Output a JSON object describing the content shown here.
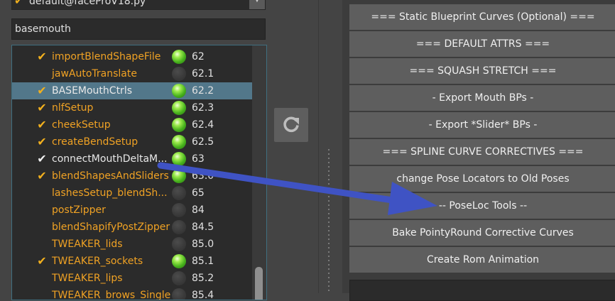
{
  "file_combo": {
    "value": "default@faceProV18.py"
  },
  "search": {
    "value": "basemouth",
    "placeholder": ""
  },
  "steps": [
    {
      "name": "importBlendShapeFile",
      "checked": "yes",
      "value": "62",
      "led": "green",
      "color": "orange"
    },
    {
      "name": "jawAutoTranslate",
      "checked": "no",
      "value": "62.1",
      "led": "dark",
      "color": "orange"
    },
    {
      "name": "BASEMouthCtrls",
      "checked": "yes",
      "value": "62.2",
      "led": "green",
      "color": "white",
      "selected": true
    },
    {
      "name": "nlfSetup",
      "checked": "yes",
      "value": "62.3",
      "led": "green",
      "color": "orange"
    },
    {
      "name": "cheekSetup",
      "checked": "yes",
      "value": "62.4",
      "led": "green",
      "color": "orange"
    },
    {
      "name": "createBendSetup",
      "checked": "yes",
      "value": "62.5",
      "led": "green",
      "color": "orange"
    },
    {
      "name": "connectMouthDeltaM...",
      "checked": "white",
      "value": "63",
      "led": "green",
      "color": "white"
    },
    {
      "name": "blendShapesAndSliders",
      "checked": "yes",
      "value": "63.0",
      "led": "green",
      "color": "orange"
    },
    {
      "name": "lashesSetup_blendSh...",
      "checked": "no",
      "value": "65",
      "led": "dark",
      "color": "orange"
    },
    {
      "name": "postZipper",
      "checked": "no",
      "value": "84",
      "led": "dark",
      "color": "orange"
    },
    {
      "name": "blendShapifyPostZipper",
      "checked": "no",
      "value": "84.5",
      "led": "dark",
      "color": "orange"
    },
    {
      "name": "TWEAKER_lids",
      "checked": "no",
      "value": "85.0",
      "led": "dark",
      "color": "orange"
    },
    {
      "name": "TWEAKER_sockets",
      "checked": "yes",
      "value": "85.1",
      "led": "green",
      "color": "orange"
    },
    {
      "name": "TWEAKER_lips",
      "checked": "no",
      "value": "85.2",
      "led": "dark",
      "color": "orange"
    },
    {
      "name": "TWEAKER_brows_Single",
      "checked": "no",
      "value": "85.4",
      "led": "dark",
      "color": "orange"
    }
  ],
  "refresh": {
    "icon": "refresh-icon"
  },
  "actions": [
    "=== Static Blueprint Curves (Optional) ===",
    "=== DEFAULT ATTRS ===",
    "=== SQUASH STRETCH ===",
    "- Export Mouth BPs -",
    "- Export *Slider* BPs -",
    "=== SPLINE CURVE CORRECTIVES ===",
    "change Pose Locators to Old Poses",
    "-- PoseLoc Tools --",
    "Bake PointyRound Corrective Curves",
    "Create Rom Animation"
  ],
  "colors": {
    "accent_check": "#f2b01e",
    "step_orange": "#f0a224",
    "selection": "#52778a",
    "annotation_arrow": "#3f53c4"
  }
}
